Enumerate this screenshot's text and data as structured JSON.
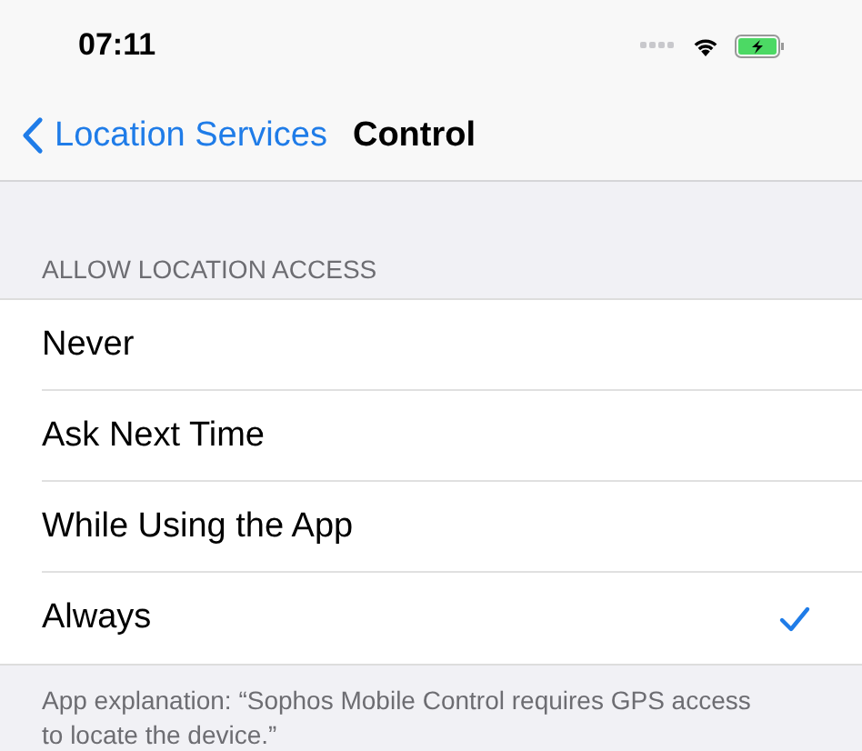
{
  "status_bar": {
    "time": "07:11"
  },
  "nav": {
    "back": "Location Services",
    "title": "Control"
  },
  "section": {
    "header": "ALLOW LOCATION ACCESS",
    "options": [
      {
        "label": "Never",
        "selected": false
      },
      {
        "label": "Ask Next Time",
        "selected": false
      },
      {
        "label": "While Using the App",
        "selected": false
      },
      {
        "label": "Always",
        "selected": true
      }
    ],
    "footer": "App explanation: “Sophos Mobile Control requires GPS access to locate the device.”"
  }
}
